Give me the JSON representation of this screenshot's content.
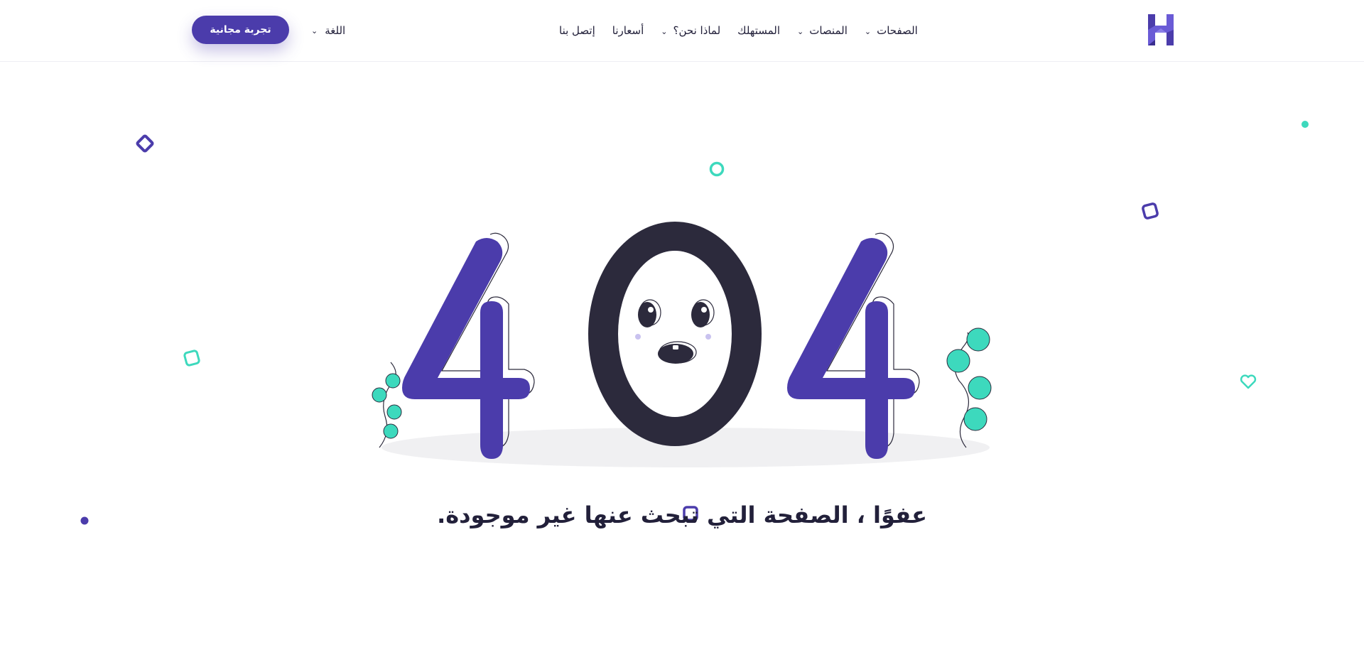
{
  "brand": {
    "logo_icon": "h-letter-logo-icon",
    "accent": "#4b3cab",
    "teal": "#3dd9bd",
    "dark": "#2c2a3c"
  },
  "nav": {
    "items": [
      {
        "label": "الصفحات",
        "has_dropdown": true
      },
      {
        "label": "المنصات",
        "has_dropdown": true
      },
      {
        "label": "المستهلك",
        "has_dropdown": false
      },
      {
        "label": "لماذا نحن؟",
        "has_dropdown": true
      },
      {
        "label": "أسعارنا",
        "has_dropdown": false
      },
      {
        "label": "إتصل بنا",
        "has_dropdown": false
      }
    ],
    "language_label": "اللغة",
    "cta_label": "تجربة مجانية"
  },
  "error": {
    "code_digits": [
      "4",
      "0",
      "4"
    ],
    "message": "عفوًا ، الصفحة التي تبحث عنها غير موجودة."
  }
}
